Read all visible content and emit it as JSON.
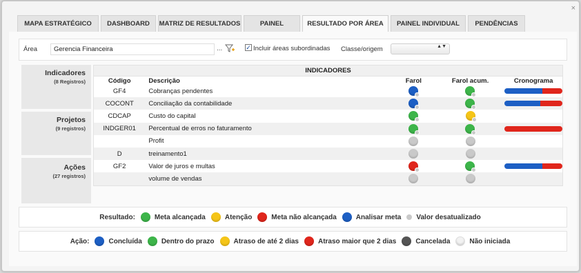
{
  "tabs": [
    {
      "label": "MAPA ESTRATÉGICO",
      "width": 118
    },
    {
      "label": "DASHBOARD",
      "width": 80
    },
    {
      "label": "MATRIZ DE RESULTADOS",
      "width": 121
    },
    {
      "label": "PAINEL",
      "width": 82
    },
    {
      "label": "RESULTADO POR ÁREA",
      "width": 125,
      "active": true
    },
    {
      "label": "PAINEL INDIVIDUAL",
      "width": 109
    },
    {
      "label": "PENDÊNCIAS",
      "width": 83
    }
  ],
  "filters": {
    "area_label": "Área",
    "area_value": "Gerencia Financeira",
    "area_dots": "...",
    "include_label": "Incluir áreas subordinadas",
    "include_checked": "✓",
    "classe_label": "Classe/origem",
    "select_arrows": "▲▼"
  },
  "sidebar": [
    {
      "title": "Indicadores",
      "sub": "(8 Registros)"
    },
    {
      "title": "Projetos",
      "sub": "(9 registros)"
    },
    {
      "title": "Ações",
      "sub": "(27 registros)"
    }
  ],
  "table": {
    "title": "INDICADORES",
    "headers": {
      "code": "Código",
      "desc": "Descrição",
      "farol": "Farol",
      "acum": "Farol acum.",
      "cron": "Cronograma"
    },
    "rows": [
      {
        "code": "GF4",
        "desc": "Cobranças pendentes",
        "farol": "blue",
        "acum": "green",
        "cron": 0.65
      },
      {
        "code": "COCONT",
        "desc": "Conciliação da contabilidade",
        "farol": "blue",
        "acum": "green",
        "cron": 0.62
      },
      {
        "code": "CDCAP",
        "desc": "Custo do capital",
        "farol": "green",
        "acum": "yellow",
        "cron": null
      },
      {
        "code": "INDGER01",
        "desc": "Percentual de erros no faturamento",
        "farol": "green",
        "acum": "green",
        "cron": 0.0
      },
      {
        "code": "",
        "desc": "Profit",
        "farol": "gray",
        "acum": "gray",
        "cron": null
      },
      {
        "code": "D",
        "desc": "treinamento1",
        "farol": "gray",
        "acum": "gray",
        "cron": null
      },
      {
        "code": "GF2",
        "desc": "Valor de juros e multas",
        "farol": "red",
        "acum": "green",
        "cron": 0.65
      },
      {
        "code": "",
        "desc": "volume de vendas",
        "farol": "gray",
        "acum": "gray",
        "cron": null
      }
    ]
  },
  "legend_result": {
    "caption": "Resultado:",
    "items": [
      {
        "label": "Meta alcançada",
        "color": "#3db54a"
      },
      {
        "label": "Atenção",
        "color": "#f5c518"
      },
      {
        "label": "Meta não alcançada",
        "color": "#e0261c"
      },
      {
        "label": "Analisar meta",
        "color": "#1d5fc4"
      },
      {
        "label": "Valor desatualizado",
        "color": "#c9c9c9",
        "small": true
      }
    ]
  },
  "legend_action": {
    "caption": "Ação:",
    "items": [
      {
        "label": "Concluída",
        "color": "#1d5fc4"
      },
      {
        "label": "Dentro do prazo",
        "color": "#3db54a"
      },
      {
        "label": "Atraso de até 2 dias",
        "color": "#f5c518"
      },
      {
        "label": "Atraso maior que 2 dias",
        "color": "#e0261c"
      },
      {
        "label": "Cancelada",
        "color": "#555555"
      },
      {
        "label": "Não iniciada",
        "color": "#f2f2f2"
      }
    ]
  },
  "colors": {
    "blue": "#1d5fc4",
    "green": "#3db54a",
    "yellow": "#f5c518",
    "red": "#e0261c",
    "gray": "#c9c9c9"
  },
  "close_label": "×"
}
